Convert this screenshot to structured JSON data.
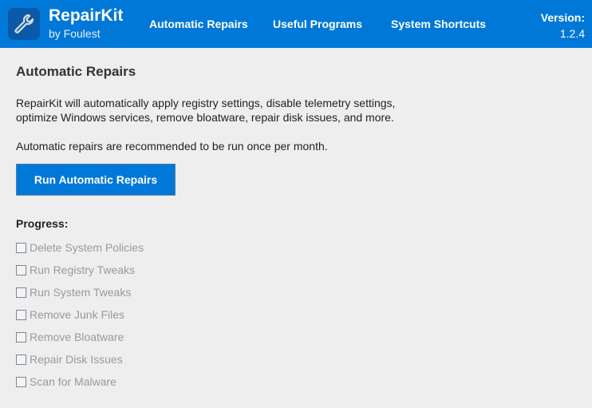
{
  "header": {
    "title": "RepairKit",
    "subtitle": "by Foulest",
    "nav": [
      "Automatic Repairs",
      "Useful Programs",
      "System Shortcuts"
    ],
    "version_label": "Version:",
    "version": "1.2.4"
  },
  "main": {
    "heading": "Automatic Repairs",
    "desc1": "RepairKit will automatically apply registry settings, disable telemetry settings,",
    "desc2": "optimize Windows services, remove bloatware, repair disk issues, and more.",
    "note": "Automatic repairs are recommended to be run once per month.",
    "button": "Run Automatic Repairs",
    "progress_label": "Progress:",
    "tasks": [
      "Delete System Policies",
      "Run Registry Tweaks",
      "Run System Tweaks",
      "Remove Junk Files",
      "Remove Bloatware",
      "Repair Disk Issues",
      "Scan for Malware"
    ]
  }
}
